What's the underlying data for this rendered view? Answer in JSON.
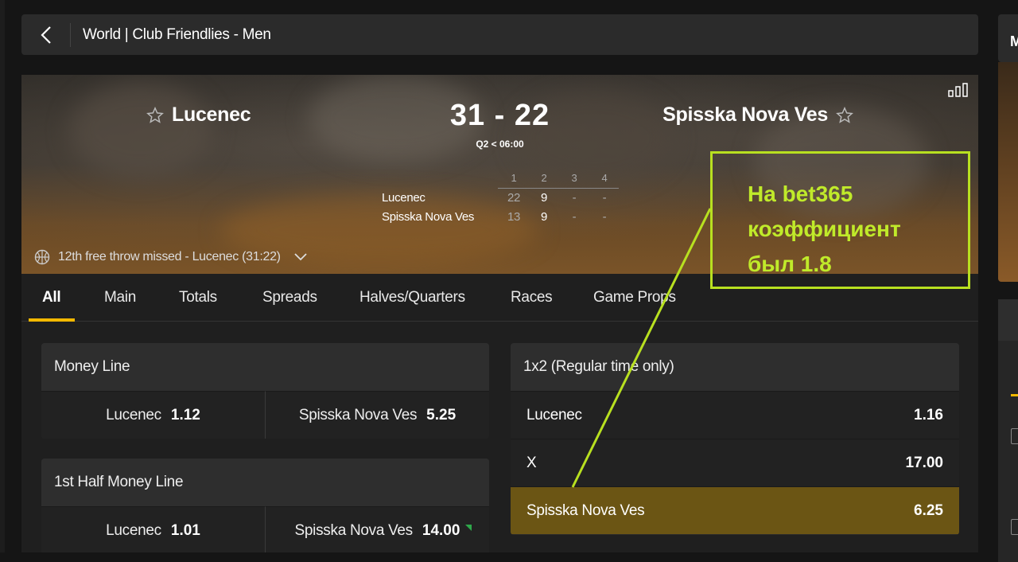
{
  "breadcrumb": {
    "title": "World | Club Friendlies - Men"
  },
  "right_panel": {
    "letter": "M"
  },
  "match": {
    "home_team": "Lucenec",
    "away_team": "Spisska Nova Ves",
    "score": "31 - 22",
    "period": "Q2 < 06:00",
    "quarters": {
      "headers": [
        "1",
        "2",
        "3",
        "4"
      ],
      "rows": [
        {
          "team": "Lucenec",
          "scores": [
            "22",
            "9",
            "-",
            "-"
          ]
        },
        {
          "team": "Spisska Nova Ves",
          "scores": [
            "13",
            "9",
            "-",
            "-"
          ]
        }
      ]
    },
    "last_event": "12th free throw missed - Lucenec (31:22)"
  },
  "tabs": [
    "All",
    "Main",
    "Totals",
    "Spreads",
    "Halves/Quarters",
    "Races",
    "Game Props"
  ],
  "markets": {
    "money_line": {
      "title": "Money Line",
      "home": {
        "name": "Lucenec",
        "price": "1.12"
      },
      "away": {
        "name": "Spisska Nova Ves",
        "price": "5.25"
      }
    },
    "first_half_money_line": {
      "title": "1st Half Money Line",
      "home": {
        "name": "Lucenec",
        "price": "1.01"
      },
      "away": {
        "name": "Spisska Nova Ves",
        "price": "14.00"
      }
    },
    "one_x_two": {
      "title": "1x2 (Regular time only)",
      "rows": [
        {
          "name": "Lucenec",
          "price": "1.16"
        },
        {
          "name": "X",
          "price": "17.00"
        },
        {
          "name": "Spisska Nova Ves",
          "price": "6.25"
        }
      ]
    }
  },
  "annotation": {
    "text": "На bet365\nкоэффициент\nбыл 1.8"
  },
  "colors": {
    "accent": "#f2b800",
    "selected": "#6b5514",
    "annotation": "#b8e020",
    "price_up": "#2ea84a"
  },
  "icons": [
    "back-arrow-icon",
    "star-outline-icon",
    "stats-bars-icon",
    "basketball-icon",
    "chevron-down-icon",
    "price-up-icon"
  ]
}
